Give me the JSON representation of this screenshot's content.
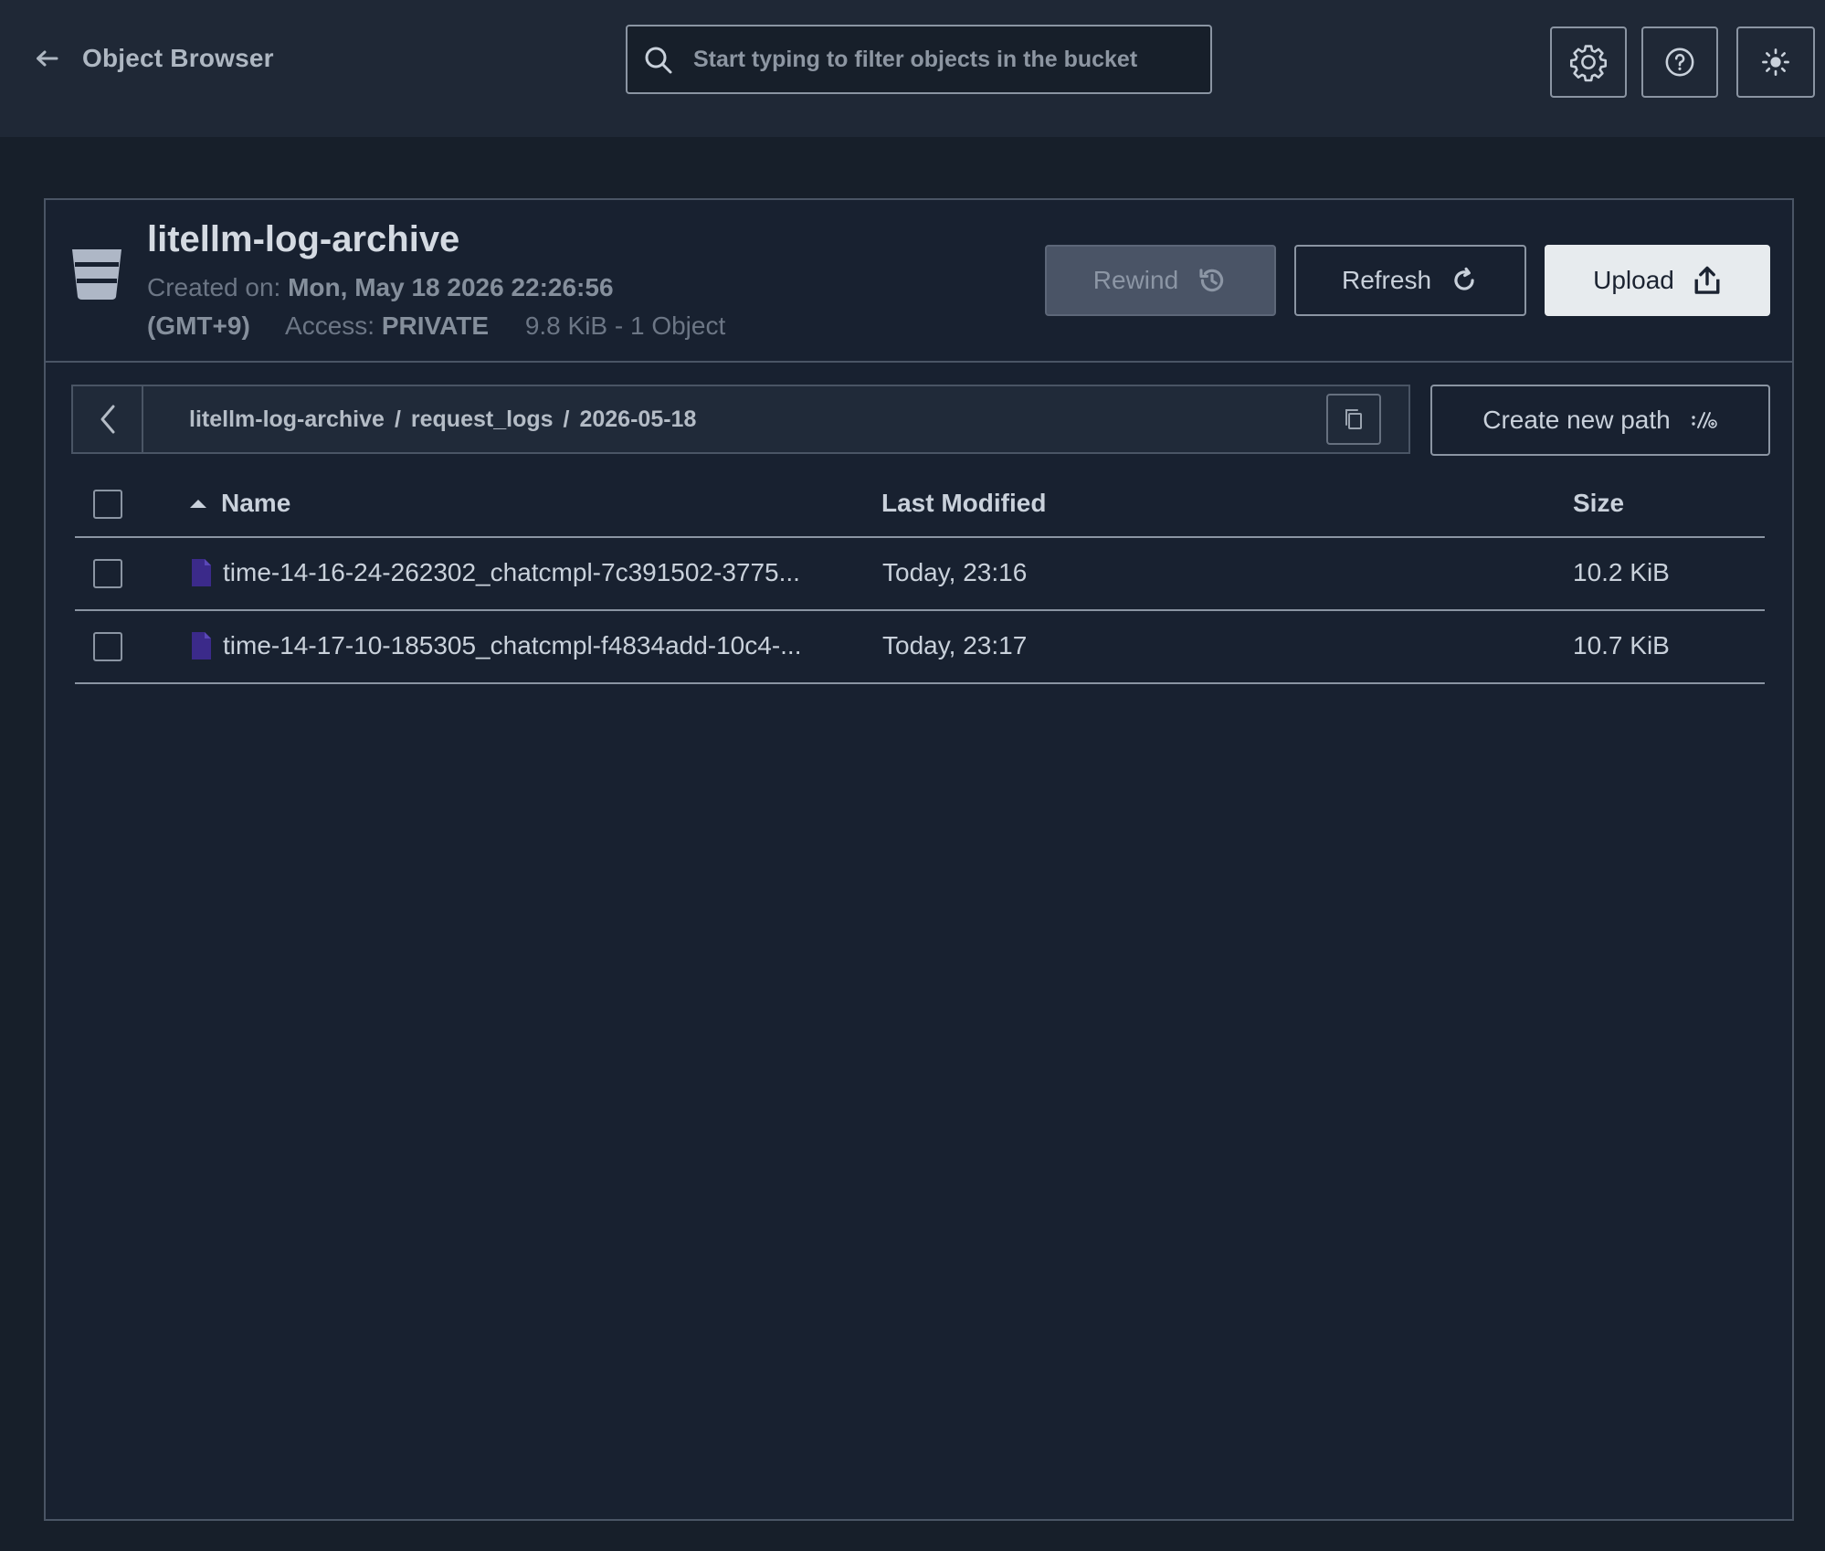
{
  "header": {
    "title": "Object Browser",
    "search_placeholder": "Start typing to filter objects in the bucket",
    "search_value": ""
  },
  "bucket": {
    "name": "litellm-log-archive",
    "created_label": "Created on:",
    "created_value_line1": "Mon, May 18 2026 22:26:56",
    "created_value_line2": "(GMT+9)",
    "access_label": "Access:",
    "access_value": "PRIVATE",
    "usage": "9.8 KiB - 1 Object"
  },
  "actions": {
    "rewind": "Rewind",
    "refresh": "Refresh",
    "upload": "Upload",
    "create_path": "Create new path"
  },
  "breadcrumb": [
    "litellm-log-archive",
    "request_logs",
    "2026-05-18"
  ],
  "breadcrumb_separator": "/",
  "table": {
    "columns": {
      "name": "Name",
      "modified": "Last Modified",
      "size": "Size"
    },
    "sort": {
      "column": "name",
      "direction": "ascending"
    },
    "rows": [
      {
        "name": "time-14-16-24-262302_chatcmpl-7c391502-3775...",
        "modified": "Today, 23:16",
        "size": "10.2 KiB"
      },
      {
        "name": "time-14-17-10-185305_chatcmpl-f4834add-10c4-...",
        "modified": "Today, 23:17",
        "size": "10.7 KiB"
      }
    ]
  },
  "icons": {
    "back": "arrow-left-icon",
    "search": "search-icon",
    "settings": "gear-icon",
    "help": "question-circle-icon",
    "theme": "sun-icon",
    "bucket": "bucket-icon",
    "rewind": "history-icon",
    "refresh": "refresh-icon",
    "upload": "upload-icon",
    "copy": "copy-icon",
    "new_path": "new-path-icon",
    "file": "file-icon",
    "sort": "sort-ascending-icon"
  },
  "colors": {
    "background": "#171f2a",
    "header_background": "#1f2836",
    "file_icon": "#3b2a8a",
    "upload_button": "#e7ebee",
    "rewind_disabled": "#4a5466"
  }
}
